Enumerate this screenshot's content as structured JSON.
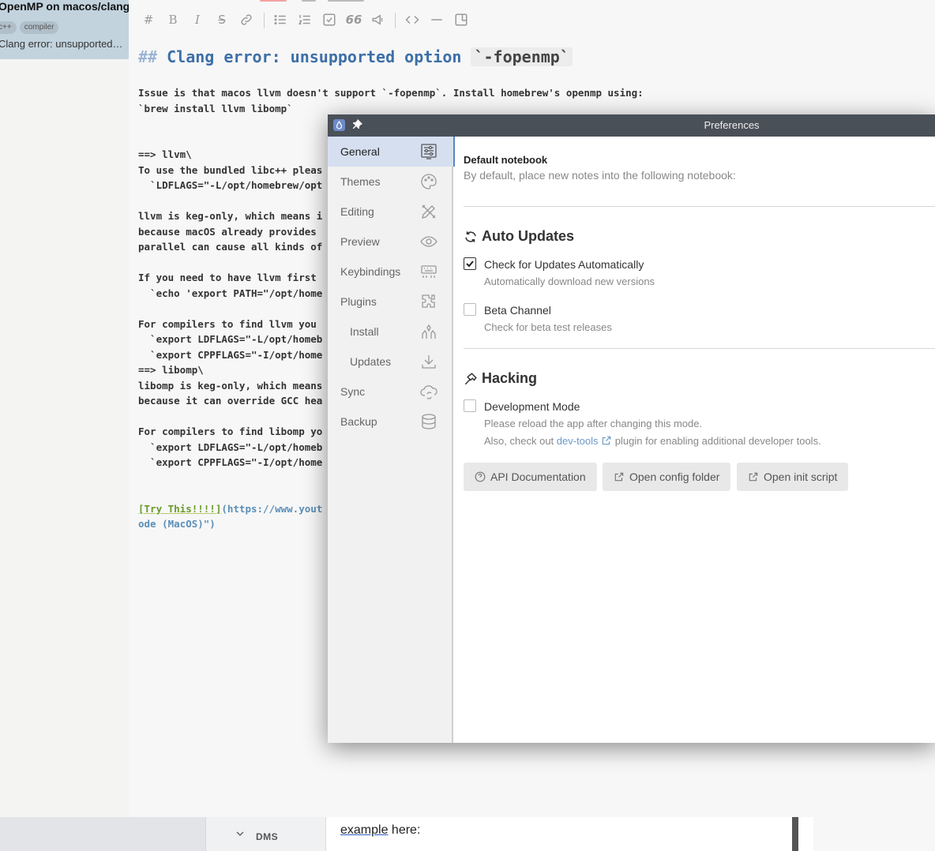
{
  "note_list": {
    "active_note": {
      "title": "OpenMP on macos/clang",
      "tags": [
        "c++",
        "compiler"
      ],
      "snippet": "Clang error: unsupported option `-fopenmp`"
    }
  },
  "editor": {
    "toolbar": {
      "heading": "heading-icon",
      "bold": "bold-icon",
      "italic": "italic-icon",
      "strike": "strikethrough-icon",
      "link": "link-icon",
      "bullet": "bullet-list-icon",
      "numbered": "numbered-list-icon",
      "task": "task-list-icon",
      "quote": "quote-icon",
      "callout": "callout-icon",
      "code": "code-icon",
      "hr": "horizontal-rule-icon",
      "image": "image-icon"
    },
    "heading_prefix": "##",
    "heading_text": "Clang error: unsupported option ",
    "heading_code": "`-fopenmp`",
    "lines": [
      "Issue is that macos llvm doesn't support `-fopenmp`. Install homebrew's openmp using:",
      "`brew install llvm libomp`",
      "",
      "",
      "==> llvm\\",
      "To use the bundled libc++ pleas",
      "  `LDFLAGS=\"-L/opt/homebrew/opt",
      "",
      "llvm is keg-only, which means i",
      "because macOS already provides ",
      "parallel can cause all kinds of",
      "",
      "If you need to have llvm first ",
      "  `echo 'export PATH=\"/opt/home",
      "",
      "For compilers to find llvm you ",
      "  `export LDFLAGS=\"-L/opt/homeb",
      "  `export CPPFLAGS=\"-I/opt/home",
      "==> libomp\\",
      "libomp is keg-only, which means",
      "because it can override GCC hea",
      "",
      "For compilers to find libomp yo",
      "  `export LDFLAGS=\"-L/opt/homeb",
      "  `export CPPFLAGS=\"-I/opt/home",
      "",
      ""
    ],
    "link_text": "[Try This!!!!]",
    "link_url": "(https://www.yout",
    "link_tail": "ode (MacOS)\")"
  },
  "background_window": {
    "nav_label": "DMS",
    "content_word": "example",
    "content_rest": " here:"
  },
  "preferences": {
    "title": "Preferences",
    "nav": [
      {
        "label": "General",
        "icon": "settings-sliders-icon",
        "active": true
      },
      {
        "label": "Themes",
        "icon": "palette-icon"
      },
      {
        "label": "Editing",
        "icon": "pencil-ruler-icon"
      },
      {
        "label": "Preview",
        "icon": "eye-icon"
      },
      {
        "label": "Keybindings",
        "icon": "keyboard-icon"
      },
      {
        "label": "Plugins",
        "icon": "puzzle-icon"
      },
      {
        "label": "Install",
        "icon": "hands-icon",
        "sub": true
      },
      {
        "label": "Updates",
        "icon": "download-icon",
        "sub": true
      },
      {
        "label": "Sync",
        "icon": "cloud-sync-icon"
      },
      {
        "label": "Backup",
        "icon": "database-icon"
      }
    ],
    "default_notebook": {
      "label": "Default notebook",
      "desc": "By default, place new notes into the following notebook:"
    },
    "auto_updates": {
      "heading": "Auto Updates",
      "check_label": "Check for Updates Automatically",
      "check_desc": "Automatically download new versions",
      "check_checked": true,
      "beta_label": "Beta Channel",
      "beta_desc": "Check for beta test releases",
      "beta_checked": false
    },
    "hacking": {
      "heading": "Hacking",
      "dev_label": "Development Mode",
      "dev_desc1": "Please reload the app after changing this mode.",
      "dev_desc2_pre": "Also, check out ",
      "dev_desc2_link": "dev-tools",
      "dev_desc2_post": " plugin for enabling additional developer tools.",
      "dev_checked": false
    },
    "buttons": {
      "api_docs": "API Documentation",
      "config_folder": "Open config folder",
      "init_script": "Open init script"
    }
  },
  "colors": {
    "accent": "#5a84c8",
    "heading": "#3d6fa8",
    "active_note_bg": "#c2d3de"
  }
}
